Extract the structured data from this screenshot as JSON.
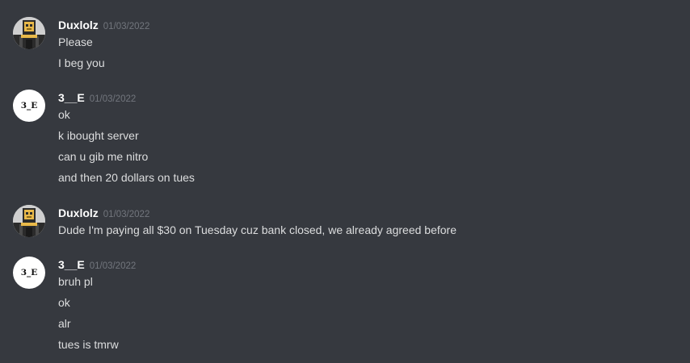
{
  "messages": [
    {
      "author": "Duxlolz",
      "timestamp": "01/03/2022",
      "avatar": "pixel-robot-icon",
      "lines": [
        "Please",
        "I beg you"
      ]
    },
    {
      "author": "3__E",
      "timestamp": "01/03/2022",
      "avatar_text": "3_E",
      "lines": [
        "ok",
        "k ibought server",
        "can u gib me nitro",
        "and then 20 dollars on tues"
      ]
    },
    {
      "author": "Duxlolz",
      "timestamp": "01/03/2022",
      "avatar": "pixel-robot-icon",
      "lines": [
        "Dude I'm paying all $30 on Tuesday cuz bank closed, we already agreed before"
      ]
    },
    {
      "author": "3__E",
      "timestamp": "01/03/2022",
      "avatar_text": "3_E",
      "lines": [
        "bruh pl",
        "ok",
        "alr",
        "tues is tmrw"
      ]
    }
  ],
  "colors": {
    "background": "#36393f",
    "username": "#ffffff",
    "timestamp": "#72767d",
    "message_text": "#dcddde"
  }
}
